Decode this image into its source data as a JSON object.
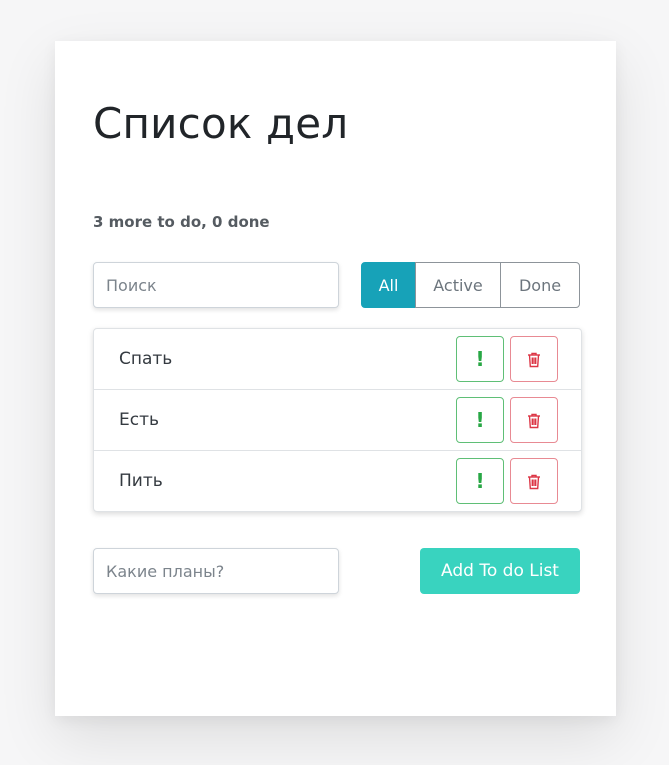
{
  "header": {
    "title": "Список дел",
    "counter": "3 more to do, 0 done"
  },
  "search": {
    "placeholder": "Поиск",
    "value": ""
  },
  "filters": [
    {
      "label": "All",
      "selected": true
    },
    {
      "label": "Active",
      "selected": false
    },
    {
      "label": "Done",
      "selected": false
    }
  ],
  "todos": [
    {
      "label": "Спать",
      "important_icon": "!",
      "delete_icon": "trash-icon"
    },
    {
      "label": "Есть",
      "important_icon": "!",
      "delete_icon": "trash-icon"
    },
    {
      "label": "Пить",
      "important_icon": "!",
      "delete_icon": "trash-icon"
    }
  ],
  "add_form": {
    "placeholder": "Какие планы?",
    "value": "",
    "button_label": "Add To do List"
  },
  "colors": {
    "filter_selected": "#17a2b8",
    "important": "#28a745",
    "delete": "#dc3545",
    "add_button": "#39d3bf"
  }
}
